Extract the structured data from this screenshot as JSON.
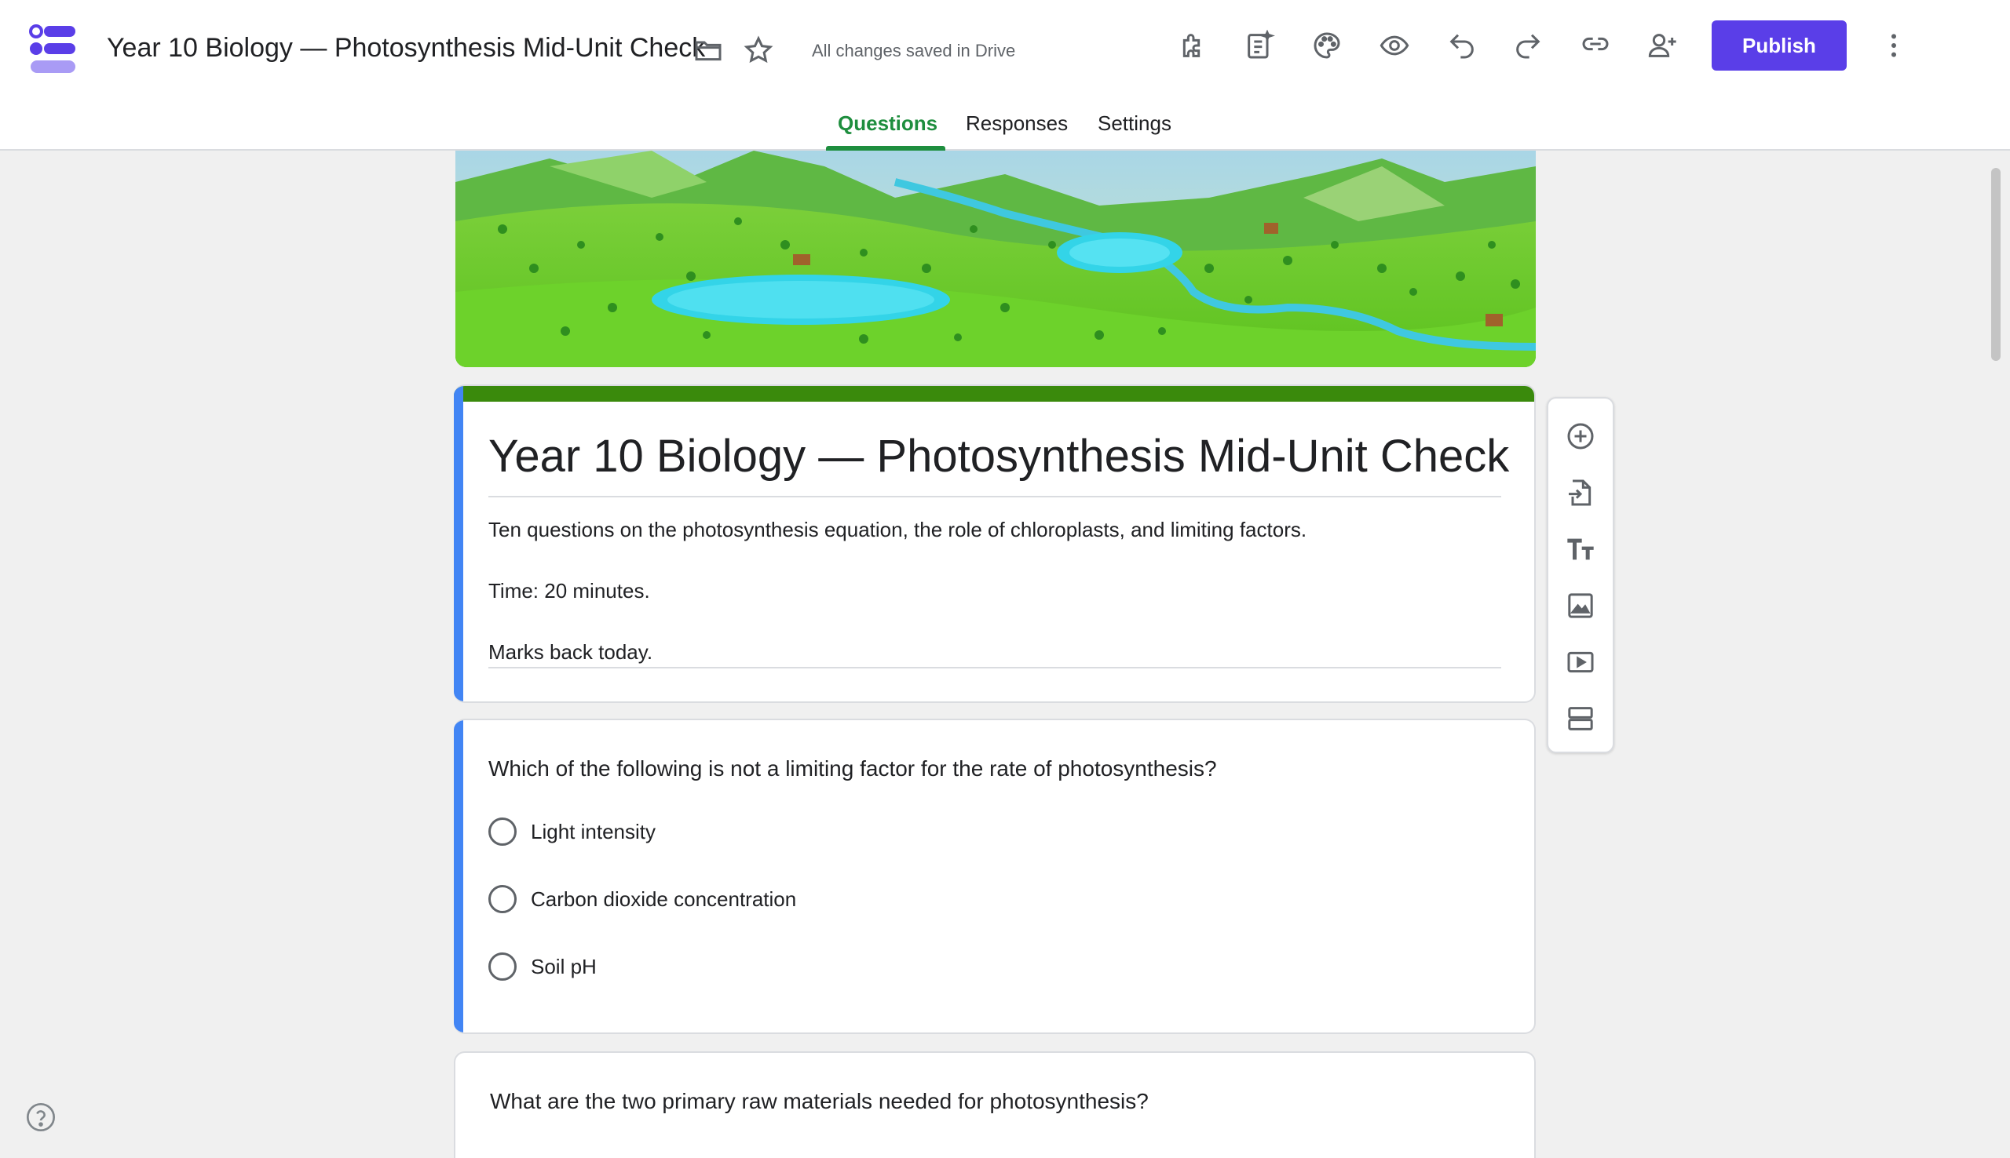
{
  "header": {
    "title": "Year 10 Biology — Photosynthesis Mid-Unit Check",
    "save_status": "All changes saved in Drive",
    "publish_label": "Publish",
    "accent_color": "#5a3ee8",
    "icons": [
      "folder-icon",
      "star-icon",
      "addons-icon",
      "ai-assist-icon",
      "palette-icon",
      "preview-icon",
      "undo-icon",
      "redo-icon",
      "link-icon",
      "add-collaborator-icon",
      "more-options-icon"
    ]
  },
  "tabs": [
    {
      "label": "Questions",
      "active": true
    },
    {
      "label": "Responses",
      "active": false
    },
    {
      "label": "Settings",
      "active": false
    }
  ],
  "form": {
    "title": "Year 10 Biology — Photosynthesis Mid-Unit Check",
    "description": [
      "Ten questions on the photosynthesis equation, the role of chloroplasts, and limiting factors.",
      "Time: 20 minutes.",
      "Marks back today."
    ],
    "theme_color": "#3a8a0c"
  },
  "questions": [
    {
      "text": "Which of the following is not a limiting factor for the rate of photosynthesis?",
      "options": [
        "Light intensity",
        "Carbon dioxide concentration",
        "Soil pH"
      ]
    },
    {
      "text": "What are the two primary raw materials needed for photosynthesis?"
    }
  ],
  "toolbar": {
    "items": [
      "add-question-icon",
      "import-questions-icon",
      "add-title-icon",
      "add-image-icon",
      "add-video-icon",
      "add-section-icon"
    ]
  }
}
